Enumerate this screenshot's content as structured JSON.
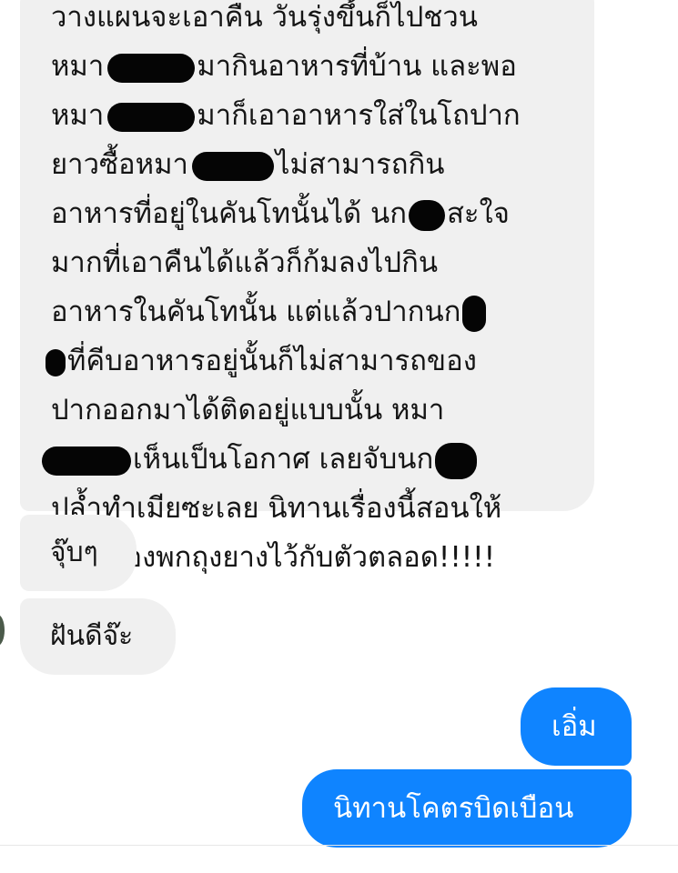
{
  "messages": {
    "long_text": {
      "lines": [
        "วางแผนจะเอาคืน วันรุ่งขึ้นก็ไปชวน",
        "หมา",
        "มากินอาหารที่บ้าน และพอ",
        "หมา",
        "มาก็เอาอาหารใส่ในโถปาก",
        "ยาวซื้อหมา",
        "ไม่สามารถกิน",
        "อาหารที่อยู่ในคันโทนั้นได้ นก",
        "สะใจ",
        "มากที่เอาคืนได้แล้วก็ก้มลงไปกิน",
        "อาหารในคันโทนั้น แต่แล้วปากนก",
        "ที่คีบอาหารอยู่นั้นก็ไม่สามารถของ",
        "ปากออกมาได้ติดอยู่แบบนั้น หมา",
        "เห็นเป็นโอกาศ เลยจับนก",
        "ปล้ำทำเมียซะเลย นิทานเรื่องนี้สอนให้",
        "รู้ว่า ต้องพกถุงยางไว้กับตัวตลอด!!!!!"
      ]
    },
    "short_1": "จุ๊บๆ",
    "short_2": "ฝันดีจ๊ะ",
    "outgoing_1": "เอิ่ม",
    "outgoing_2": "นิทานโคตรบิดเบือน"
  },
  "colors": {
    "incoming_bg": "#f0f0f0",
    "outgoing_bg": "#0f84ff",
    "redaction": "#050505"
  }
}
